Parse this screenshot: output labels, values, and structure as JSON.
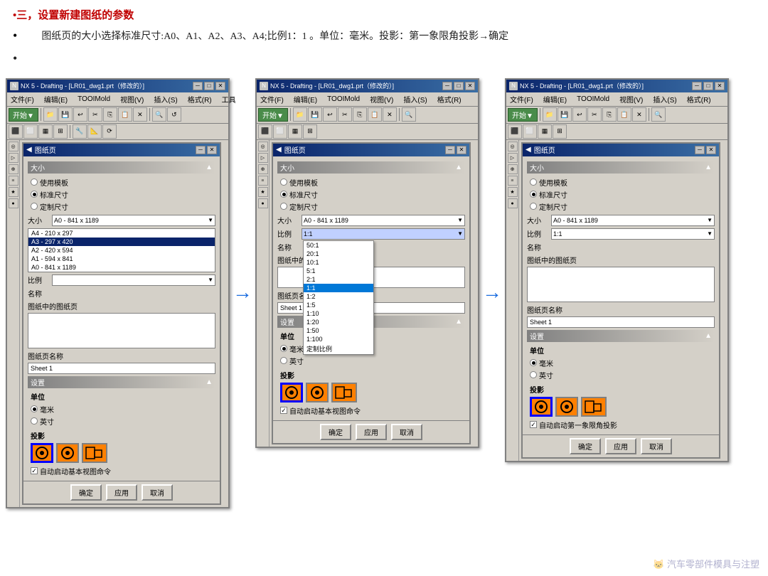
{
  "page": {
    "heading": "•三，设置新建图纸的参数",
    "bullet1_prefix": "•",
    "bullet1_indent": "     ",
    "bullet1_text": "图纸页的大小选择标准尺寸:A0、A1、A2、A3、A4;比例1：1 。单位：毫米。投影：第一象限角投影→确定",
    "bullet2": "•"
  },
  "window": {
    "title": "NX 5 - Drafting - [LR01_dwg1.prt（修改的）]",
    "menu_items": [
      "文件(F)",
      "编辑(E)",
      "TOOIMold",
      "视图(V)",
      "插入(S)",
      "格式(R)",
      "工具"
    ]
  },
  "dialog": {
    "title": "图纸页",
    "section_size": "大小",
    "radio_use_template": "使用模板",
    "radio_standard": "标准尺寸",
    "radio_custom": "定制尺寸",
    "label_size": "大小",
    "label_ratio": "比例",
    "label_name": "名称",
    "label_sheets": "图纸中的图纸页",
    "label_sheet_name": "图纸页名称",
    "section_settings": "设置",
    "section_unit": "单位",
    "radio_mm": "毫米",
    "radio_inch": "英寸",
    "section_projection": "投影",
    "checkbox_auto": "自动启动基本视图命令",
    "checkbox_auto2": "自动启动基本视图命令",
    "checkbox_auto3": "自动启动第一象限角投影",
    "btn_ok": "确定",
    "btn_apply": "应用",
    "btn_cancel": "取消"
  },
  "panel1": {
    "size_value": "A0 - 841 x 1189",
    "size_options": [
      "A0 - 841 x 1189",
      "A4 - 210 x 297",
      "A3 - 297 x 420",
      "A2 - 420 x 594",
      "A1 - 594 x 841",
      "A0 - 841 x 1189"
    ],
    "selected_size": "A3 - 297 x 420",
    "ratio_value": "",
    "sheet_name": "Sheet 1"
  },
  "panel2": {
    "size_value": "A0 - 841 x 1189",
    "ratio_value": "1:1",
    "ratio_options": [
      "50:1",
      "20:1",
      "10:1",
      "5:1",
      "2:1",
      "1:1",
      "1:2",
      "1:5",
      "1:10",
      "1:20",
      "1:50",
      "1:100",
      "定制比例"
    ],
    "selected_ratio": "1:1",
    "sheet_name": "Sheet 1"
  },
  "panel3": {
    "size_value": "A0 - 841 x 1189",
    "ratio_value": "1:1",
    "sheet_name": "Sheet 1"
  },
  "icons": {
    "arrow": "→",
    "collapse": "─",
    "close_x": "✕",
    "min": "─",
    "max": "□",
    "check": "✓"
  }
}
